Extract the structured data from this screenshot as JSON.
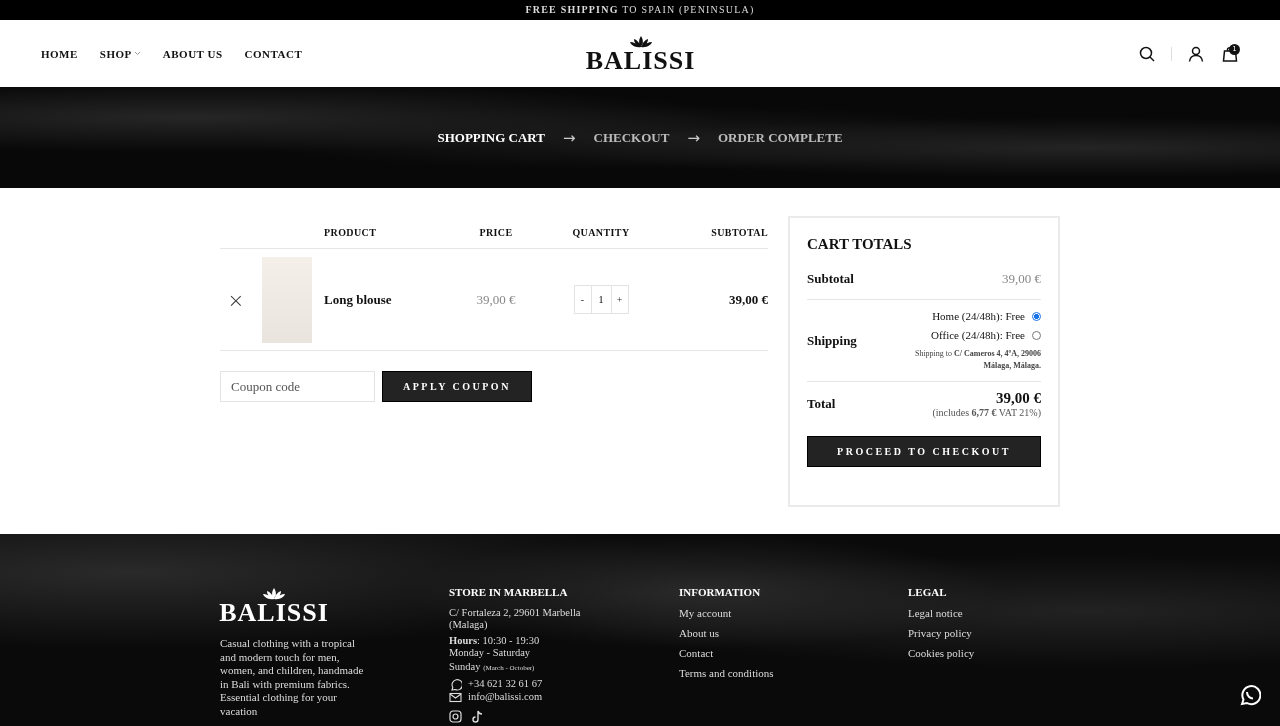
{
  "announcement": "**FREE SHIPPING** TO SPAIN (PENINSULA)",
  "nav": [
    {
      "label": "HOME",
      "dropdown": false
    },
    {
      "label": "SHOP",
      "dropdown": true
    },
    {
      "label": "ABOUT US",
      "dropdown": false
    },
    {
      "label": "CONTACT",
      "dropdown": false
    }
  ],
  "logo": "BALISSI",
  "cart_count": "1",
  "steps": [
    {
      "label": "SHOPPING CART",
      "selected": true
    },
    {
      "label": "CHECKOUT",
      "selected": false
    },
    {
      "label": "ORDER COMPLETE",
      "selected": false
    }
  ],
  "step_separator": "→",
  "cart": {
    "columns": [
      "PRODUCT",
      "PRICE",
      "QUANTITY",
      "SUBTOTAL"
    ],
    "rows": [
      {
        "remove": "×",
        "product": "Long blouse",
        "price": "39,00 €",
        "minus": "-",
        "quantity": "1",
        "plus": "+",
        "subtotal": "39,00 €"
      }
    ],
    "coupon": {
      "placeholder": "Coupon code",
      "button": "APPLY COUPON"
    }
  },
  "totals": {
    "title": "CART TOTALS",
    "subtotal_label": "Subtotal",
    "subtotal": "39,00 €",
    "shipping_label": "Shipping",
    "shipping_options": [
      {
        "label": "Home (24/48h): Free",
        "selected": true
      },
      {
        "label": "Office (24/48h): Free",
        "selected": false
      }
    ],
    "shipping_to": "Shipping to **C/ Cameros 4, 4ºA, 29006 Málaga, Málaga.**",
    "total_label": "Total",
    "total": "39,00 €",
    "vat_note": "(includes **6,77 €** VAT 21%)",
    "checkout_button": "PROCEED TO CHECKOUT"
  },
  "footer": {
    "logo": "BALISSI",
    "about": "Casual clothing with a tropical and modern touch for men, women, and children, handmade in Bali with premium fabrics. Essential clothing for your vacation",
    "store": {
      "title": "STORE IN MARBELLA",
      "address": "C/ Fortaleza 2, 29601 Marbella (Malaga)",
      "hours": "**Hours**: 10:30 - 19:30",
      "days": "Monday - Saturday",
      "sunday": "Sunday",
      "sunday_note": "(March - October)",
      "phone": "+34 621 32 61 67",
      "email": "info@balissi.com"
    },
    "columns": [
      {
        "title": "INFORMATION",
        "links": [
          "My account",
          "About us",
          "Contact",
          "Terms and conditions"
        ]
      },
      {
        "title": "LEGAL",
        "links": [
          "Legal notice",
          "Privacy policy",
          "Cookies policy"
        ]
      }
    ]
  }
}
